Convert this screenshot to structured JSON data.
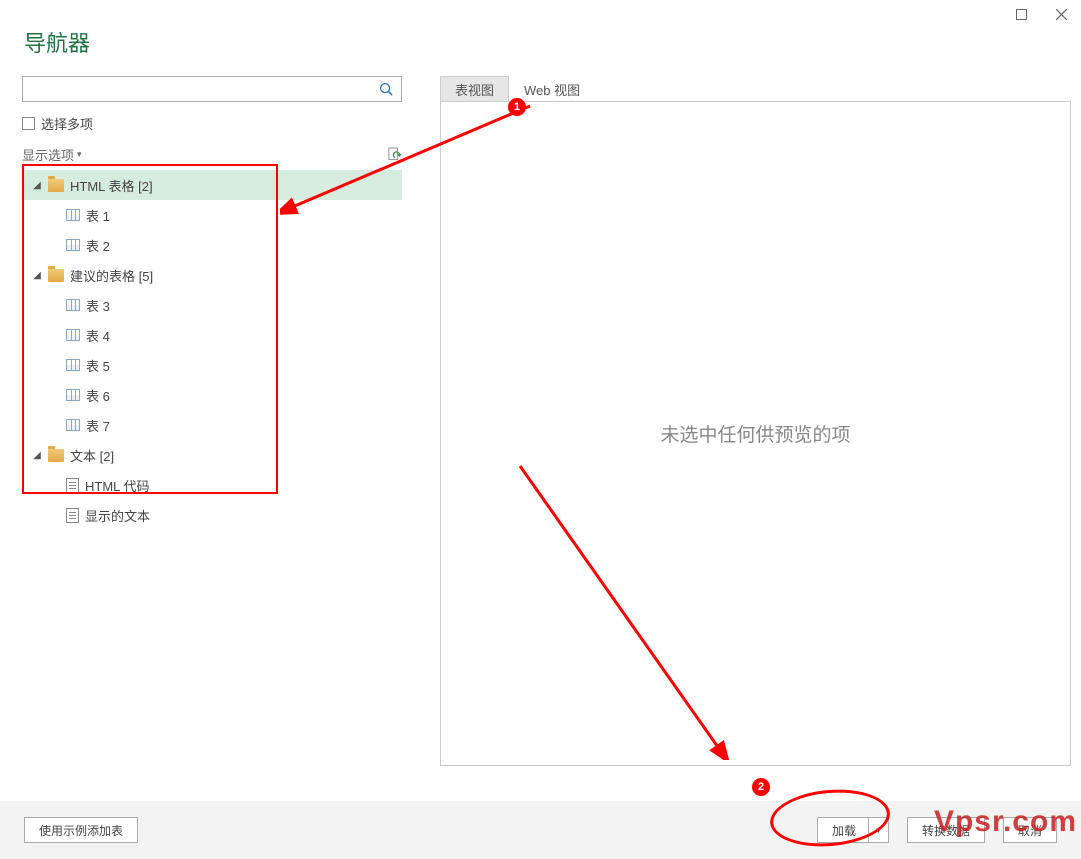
{
  "window": {
    "title": "导航器"
  },
  "search": {
    "placeholder": ""
  },
  "checkbox": {
    "label": "选择多项"
  },
  "options": {
    "label": "显示选项"
  },
  "tree": {
    "groups": [
      {
        "label": "HTML 表格 [2]",
        "selected": true,
        "items": [
          {
            "label": "表 1",
            "icon": "table"
          },
          {
            "label": "表 2",
            "icon": "table"
          }
        ]
      },
      {
        "label": "建议的表格 [5]",
        "selected": false,
        "items": [
          {
            "label": "表 3",
            "icon": "table"
          },
          {
            "label": "表 4",
            "icon": "table"
          },
          {
            "label": "表 5",
            "icon": "table"
          },
          {
            "label": "表 6",
            "icon": "table"
          },
          {
            "label": "表 7",
            "icon": "table"
          }
        ]
      },
      {
        "label": "文本 [2]",
        "selected": false,
        "items": [
          {
            "label": "HTML 代码",
            "icon": "doc"
          },
          {
            "label": "显示的文本",
            "icon": "doc"
          }
        ]
      }
    ]
  },
  "tabs": {
    "table_view": "表视图",
    "web_view": "Web 视图"
  },
  "preview": {
    "empty_text": "未选中任何供预览的项"
  },
  "footer": {
    "add_table": "使用示例添加表",
    "load": "加载",
    "transform": "转换数据",
    "cancel": "取消"
  },
  "annotations": {
    "marker1": "1",
    "marker2": "2"
  },
  "watermark": "Vpsr.com"
}
